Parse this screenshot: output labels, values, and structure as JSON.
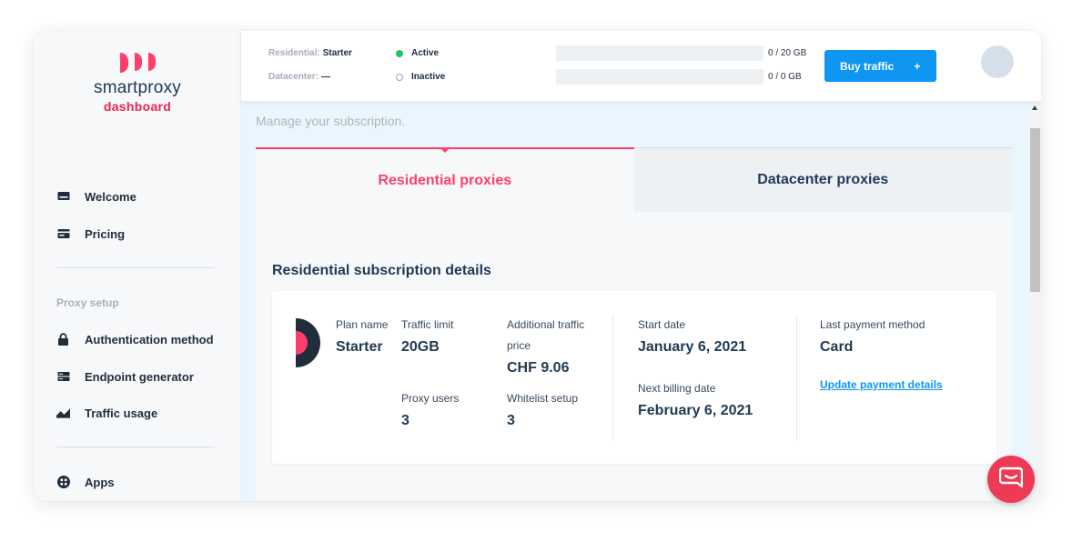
{
  "brand": {
    "name": "smartproxy",
    "subtitle": "dashboard",
    "accent": "#ff3f6b",
    "blue": "#0f96f2"
  },
  "sidebar": {
    "items": [
      {
        "label": "Welcome",
        "icon": "monitor-icon"
      },
      {
        "label": "Pricing",
        "icon": "card-icon"
      }
    ],
    "section_label": "Proxy setup",
    "setup_items": [
      {
        "label": "Authentication method",
        "icon": "lock-icon"
      },
      {
        "label": "Endpoint generator",
        "icon": "server-icon"
      },
      {
        "label": "Traffic usage",
        "icon": "chart-icon"
      }
    ],
    "apps_label": "Apps"
  },
  "header": {
    "residential": {
      "label": "Residential:",
      "plan": "Starter",
      "status": "Active",
      "usage_text": "0 / 20 GB",
      "usage_fraction": 0
    },
    "datacenter": {
      "label": "Datacenter:",
      "plan": "—",
      "status": "Inactive",
      "usage_text": "0 / 0 GB",
      "usage_fraction": 0
    },
    "buy_button": "Buy traffic",
    "buy_plus": "+"
  },
  "main": {
    "subtitle": "Manage your subscription.",
    "tabs": [
      {
        "label": "Residential proxies",
        "active": true
      },
      {
        "label": "Datacenter proxies",
        "active": false
      }
    ],
    "section_title": "Residential subscription details",
    "details": {
      "plan_name_label": "Plan name",
      "plan_name": "Starter",
      "traffic_limit_label": "Traffic limit",
      "traffic_limit": "20GB",
      "additional_traffic_label_1": "Additional traffic",
      "additional_traffic_label_2": "price",
      "additional_traffic_price": "CHF 9.06",
      "proxy_users_label": "Proxy users",
      "proxy_users": "3",
      "whitelist_label": "Whitelist setup",
      "whitelist": "3",
      "start_date_label": "Start date",
      "start_date": "January 6, 2021",
      "next_billing_label": "Next billing date",
      "next_billing": "February 6, 2021",
      "payment_method_label": "Last payment method",
      "payment_method": "Card",
      "update_link": "Update payment details"
    }
  }
}
